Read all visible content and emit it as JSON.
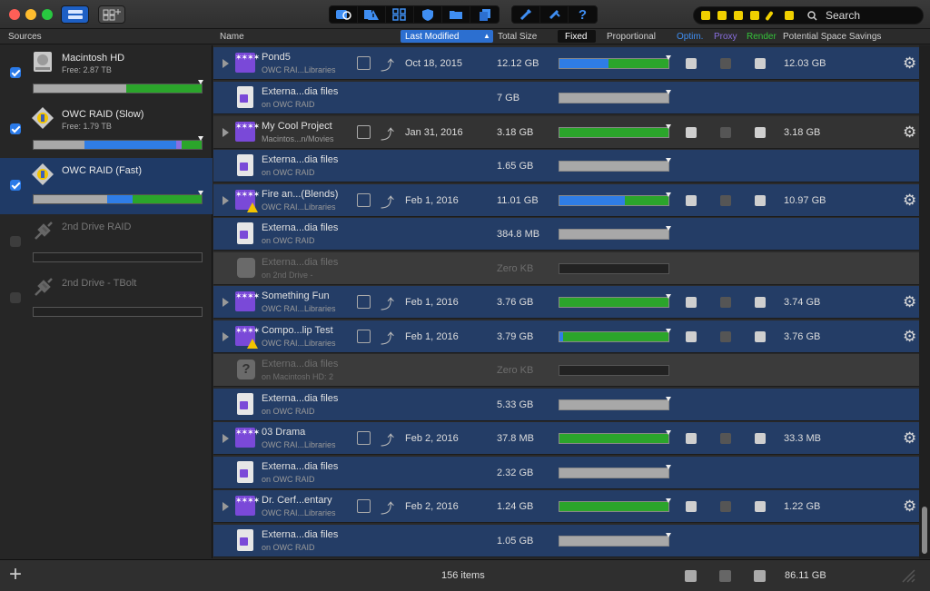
{
  "toolbar": {
    "search_label": "Search"
  },
  "columns": {
    "sources": "Sources",
    "name": "Name",
    "last_modified": "Last Modified",
    "sort_arrow": "▲",
    "total_size": "Total Size",
    "fixed": "Fixed",
    "proportional": "Proportional",
    "optim": "Optim.",
    "proxy": "Proxy",
    "render": "Render",
    "savings": "Potential Space Savings"
  },
  "colors": {
    "optim": "#3f8ef2",
    "proxy": "#8a6fe0",
    "render": "#35c33a",
    "selection": "#1f3a66",
    "blue_bar": "#2f7de6",
    "green_bar": "#2ba52b",
    "gray_bar": "#a8a8a8"
  },
  "sources": [
    {
      "name": "Macintosh HD",
      "free": "Free: 2.87 TB",
      "checked": true,
      "icon": "hard-disk-icon"
    },
    {
      "name": "OWC RAID (Slow)",
      "free": "Free: 1.79 TB",
      "checked": true,
      "icon": "library-badge-icon"
    },
    {
      "name": "OWC RAID (Fast)",
      "free": "",
      "checked": true,
      "icon": "library-badge-icon"
    },
    {
      "name": "2nd Drive RAID",
      "free": "",
      "checked": false,
      "icon": "unplugged-icon"
    },
    {
      "name": "2nd Drive - TBolt",
      "free": "",
      "checked": false,
      "icon": "unplugged-icon"
    }
  ],
  "rows": [
    {
      "name": "Pond5",
      "sub": "OWC RAI...Libraries",
      "date": "Oct 18, 2015",
      "size": "12.12 GB",
      "savings": "12.03 GB"
    },
    {
      "name": "Externa...dia files",
      "sub": "on OWC RAID",
      "size": "7 GB"
    },
    {
      "name": "My Cool Project",
      "sub": "Macintos...n/Movies",
      "date": "Jan 31, 2016",
      "size": "3.18 GB",
      "savings": "3.18 GB"
    },
    {
      "name": "Externa...dia files",
      "sub": "on OWC RAID",
      "size": "1.65 GB"
    },
    {
      "name": "Fire an...(Blends)",
      "sub": "OWC RAI...Libraries",
      "date": "Feb 1, 2016",
      "size": "11.01 GB",
      "savings": "10.97 GB"
    },
    {
      "name": "Externa...dia files",
      "sub": "on OWC RAID",
      "size": "384.8 MB"
    },
    {
      "name": "Externa...dia files",
      "sub": "on 2nd Drive -",
      "size": "Zero KB"
    },
    {
      "name": "Something Fun",
      "sub": "OWC RAI...Libraries",
      "date": "Feb 1, 2016",
      "size": "3.76 GB",
      "savings": "3.74 GB"
    },
    {
      "name": "Compo...lip Test",
      "sub": "OWC RAI...Libraries",
      "date": "Feb 1, 2016",
      "size": "3.79 GB",
      "savings": "3.76 GB"
    },
    {
      "name": "Externa...dia files",
      "sub": "on Macintosh HD: 2",
      "size": "Zero KB"
    },
    {
      "name": "Externa...dia files",
      "sub": "on OWC RAID",
      "size": "5.33 GB"
    },
    {
      "name": "03 Drama",
      "sub": "OWC RAI...Libraries",
      "date": "Feb 2, 2016",
      "size": "37.8 MB",
      "savings": "33.3 MB"
    },
    {
      "name": "Externa...dia files",
      "sub": "on OWC RAID",
      "size": "2.32 GB"
    },
    {
      "name": "Dr. Cerf...entary",
      "sub": "OWC RAI...Libraries",
      "date": "Feb 2, 2016",
      "size": "1.24 GB",
      "savings": "1.22 GB"
    },
    {
      "name": "Externa...dia files",
      "sub": "on OWC RAID",
      "size": "1.05 GB"
    }
  ],
  "footer": {
    "item_count": "156 items",
    "total_savings": "86.11 GB",
    "add_glyph": "+"
  },
  "glyphs": {
    "gear": "⚙",
    "question": "?",
    "move": "⤴",
    "libstars": "✶✶✶✶"
  }
}
